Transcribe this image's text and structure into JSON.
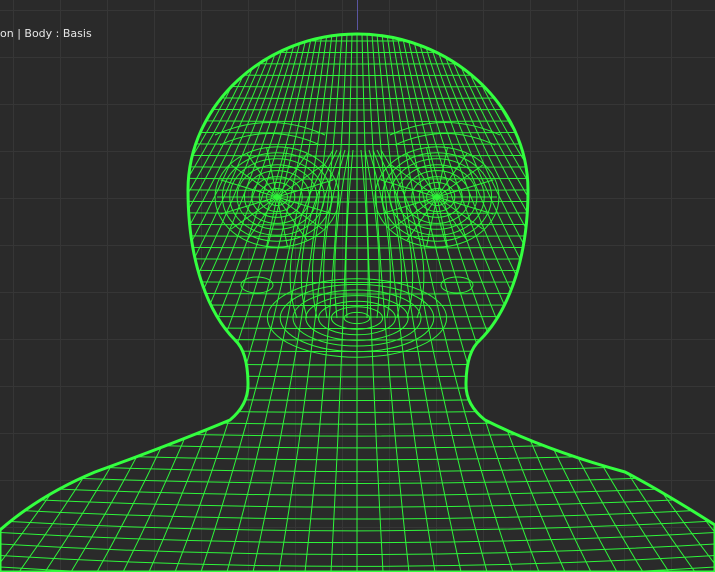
{
  "viewport": {
    "header_text": "on | Body : Basis"
  },
  "colors": {
    "background": "#2a2a2a",
    "grid": "#363636",
    "wire": "#2ef53a",
    "outline": "#33ff3f",
    "axis": "#5a55a0"
  },
  "icons": {
    "mesh": "wireframe-head-mesh"
  }
}
